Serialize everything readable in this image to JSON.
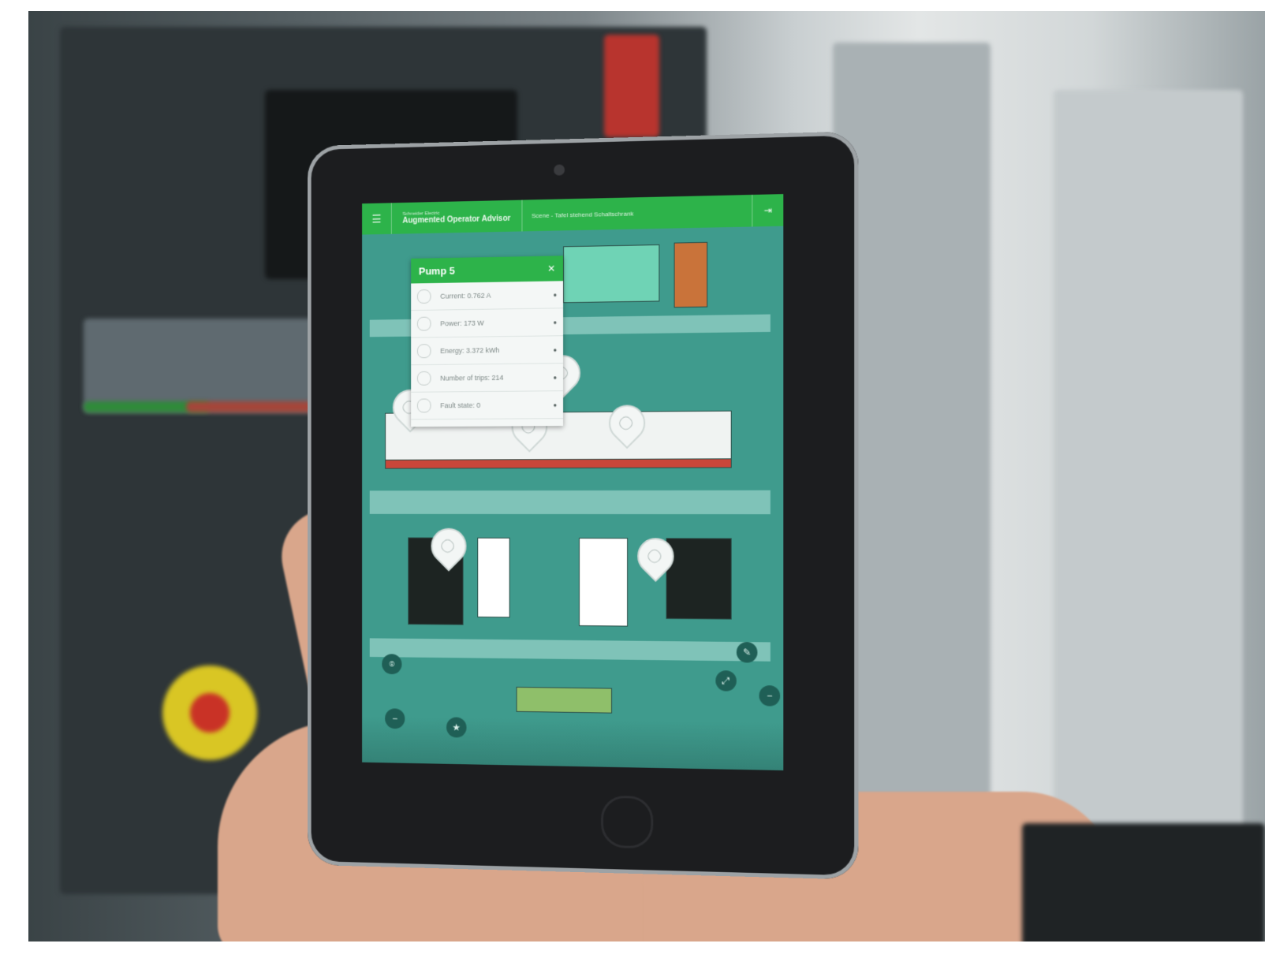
{
  "app": {
    "brand_small": "Schneider Electric",
    "brand_title": "Augmented Operator Advisor",
    "breadcrumb": "Scene - Tafel stehend Schaltschrank",
    "menu_icon": "hamburger-icon",
    "exit_icon": "exit-icon"
  },
  "popup": {
    "title": "Pump 5",
    "close_icon": "close-icon",
    "rows": [
      {
        "label": "Current: 0.762 A"
      },
      {
        "label": "Power: 173 W"
      },
      {
        "label": "Energy: 3.372 kWh"
      },
      {
        "label": "Number of trips: 214"
      },
      {
        "label": "Fault state: 0"
      }
    ]
  },
  "controls": {
    "edit_icon": "pencil-icon",
    "expand_icon": "expand-icon",
    "minus_icon": "minus-icon",
    "pin_icon": "pin-icon",
    "star_icon": "star-icon"
  },
  "colors": {
    "accent": "#2db34a",
    "overlay": "#4da89a"
  }
}
